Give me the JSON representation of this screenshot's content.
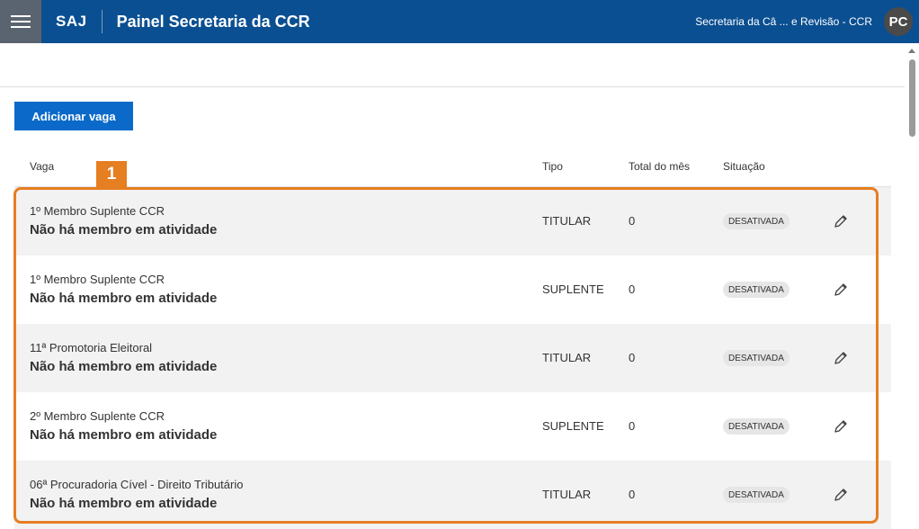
{
  "header": {
    "brand": "SAJ",
    "title": "Painel Secretaria da CCR",
    "user_context": "Secretaria da Câ ... e Revisão - CCR",
    "avatar_initials": "PC",
    "bar_color": "#0a4f91"
  },
  "toolbar": {
    "add_label": "Adicionar vaga",
    "add_color": "#0b6ac9"
  },
  "table": {
    "columns": [
      "Vaga",
      "Tipo",
      "Total do mês",
      "Situação"
    ],
    "rows": [
      {
        "name": "1º Membro Suplente CCR",
        "member": "Não há membro em atividade",
        "tipo": "TITULAR",
        "total": "0",
        "status": "DESATIVADA"
      },
      {
        "name": "1º Membro Suplente CCR",
        "member": "Não há membro em atividade",
        "tipo": "SUPLENTE",
        "total": "0",
        "status": "DESATIVADA"
      },
      {
        "name": "11ª Promotoria Eleitoral",
        "member": "Não há membro em atividade",
        "tipo": "TITULAR",
        "total": "0",
        "status": "DESATIVADA"
      },
      {
        "name": "2º Membro Suplente CCR",
        "member": "Não há membro em atividade",
        "tipo": "SUPLENTE",
        "total": "0",
        "status": "DESATIVADA"
      },
      {
        "name": "06ª Procuradoria Cível - Direito Tributário",
        "member": "Não há membro em atividade",
        "tipo": "TITULAR",
        "total": "0",
        "status": "DESATIVADA"
      }
    ]
  },
  "annotation": {
    "label": "1",
    "color": "#e67e22"
  },
  "icons": {
    "menu": "hamburger-icon",
    "edit": "pencil-icon"
  }
}
